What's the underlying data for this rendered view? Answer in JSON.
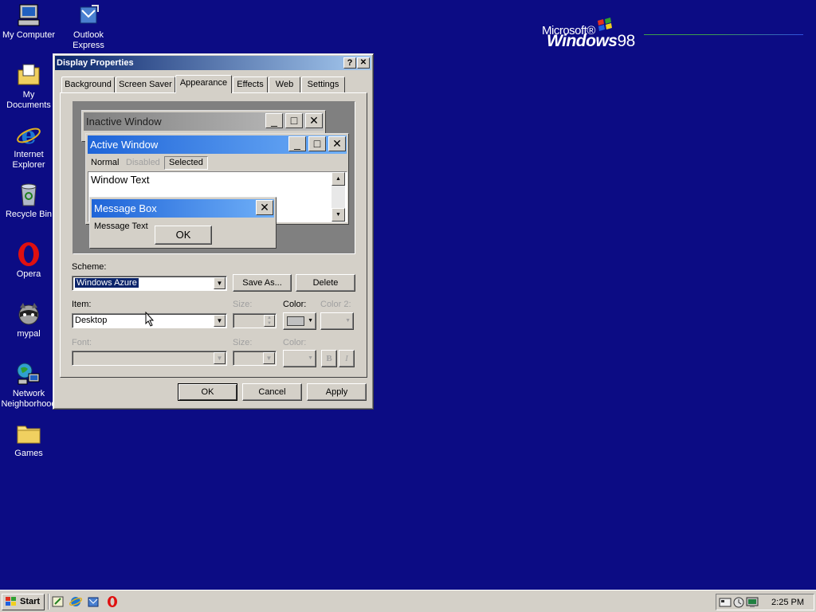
{
  "desktop": {
    "icons": [
      {
        "label": "My Computer",
        "icon": "my-computer-icon"
      },
      {
        "label": "Outlook Express",
        "icon": "outlook-express-icon"
      },
      {
        "label": "My Documents",
        "icon": "my-documents-icon"
      },
      {
        "label": "Internet Explorer",
        "icon": "internet-explorer-icon"
      },
      {
        "label": "Recycle Bin",
        "icon": "recycle-bin-icon"
      },
      {
        "label": "Opera",
        "icon": "opera-icon"
      },
      {
        "label": "mypal",
        "icon": "mypal-icon"
      },
      {
        "label": "Network Neighborhood",
        "icon": "network-neighborhood-icon"
      },
      {
        "label": "Games",
        "icon": "folder-icon"
      }
    ],
    "logo": {
      "microsoft": "Microsoft®",
      "windows": "Windows",
      "version": "98"
    }
  },
  "dialog": {
    "title": "Display Properties",
    "help_label": "?",
    "close_label": "✕",
    "tabs": [
      "Background",
      "Screen Saver",
      "Appearance",
      "Effects",
      "Web",
      "Settings"
    ],
    "active_tab": "Appearance",
    "preview": {
      "inactive_title": "Inactive Window",
      "active_title": "Active Window",
      "menu": {
        "normal": "Normal",
        "disabled": "Disabled",
        "selected": "Selected"
      },
      "window_text": "Window Text",
      "message_box_title": "Message Box",
      "message_text": "Message Text",
      "ok_label": "OK"
    },
    "scheme": {
      "label": "Scheme:",
      "value": "Windows Azure",
      "save_as": "Save As...",
      "delete": "Delete"
    },
    "item": {
      "label": "Item:",
      "value": "Desktop",
      "size_label": "Size:",
      "color_label": "Color:",
      "color2_label": "Color 2:"
    },
    "font": {
      "label": "Font:",
      "size_label": "Size:",
      "color_label": "Color:",
      "bold": "B",
      "italic": "I"
    },
    "buttons": {
      "ok": "OK",
      "cancel": "Cancel",
      "apply": "Apply"
    }
  },
  "taskbar": {
    "start_label": "Start",
    "clock": "2:25 PM",
    "quick_launch": [
      "show-desktop-icon",
      "internet-explorer-icon",
      "outlook-express-icon",
      "opera-icon"
    ]
  },
  "colors": {
    "desktop": "#0c0c84",
    "active_title": "#0a246a",
    "preview_active": "#3a80e8",
    "face": "#d4d0c8"
  }
}
